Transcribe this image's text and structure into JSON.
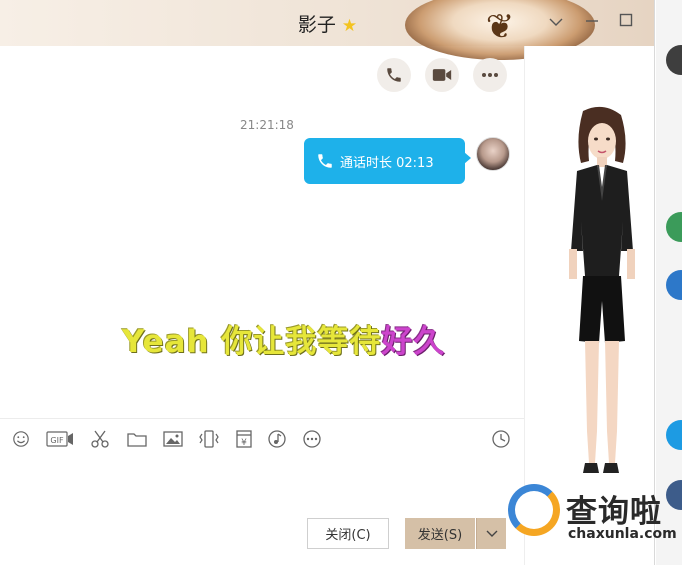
{
  "window": {
    "title": "影子",
    "star": "★"
  },
  "chat": {
    "timestamp": "21:21:18",
    "call_duration": "通话时长 02:13"
  },
  "lyric": {
    "part1": "Yeah 你让我等待",
    "part2": "好久"
  },
  "toolbar": {
    "gif_label": "GIF",
    "yen_symbol": "¥"
  },
  "buttons": {
    "close_label": "关闭(C)",
    "send_label": "发送(S)"
  },
  "watermark": {
    "brand": "查询啦",
    "url": "chaxunla.com"
  },
  "colors": {
    "bubble": "#1eb1ea",
    "send_button": "#d5c0a7",
    "lyric_yellow": "#e6e63a",
    "lyric_purple": "#cc44cc"
  },
  "icons": [
    "phone-icon",
    "video-icon",
    "more-icon",
    "emoji-icon",
    "gif-icon",
    "scissors-icon",
    "folder-icon",
    "image-icon",
    "vibrate-icon",
    "red-packet-icon",
    "music-icon",
    "ellipsis-icon",
    "history-clock-icon",
    "chevron-down-icon",
    "minimize-icon",
    "maximize-icon"
  ]
}
